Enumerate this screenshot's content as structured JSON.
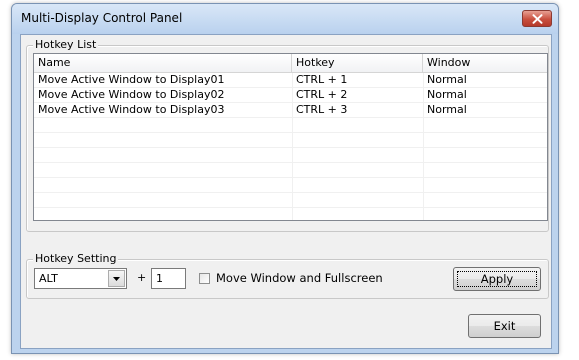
{
  "window": {
    "title": "Multi-Display Control Panel"
  },
  "hotkey_list": {
    "group_label": "Hotkey List",
    "columns": [
      "Name",
      "Hotkey",
      "Window"
    ],
    "rows": [
      {
        "name": "Move Active Window to Display01",
        "hotkey": "CTRL + 1",
        "window": "Normal"
      },
      {
        "name": "Move Active Window to Display02",
        "hotkey": "CTRL + 2",
        "window": "Normal"
      },
      {
        "name": "Move Active Window to Display03",
        "hotkey": "CTRL + 3",
        "window": "Normal"
      }
    ]
  },
  "hotkey_setting": {
    "group_label": "Hotkey Setting",
    "modifier_selected": "ALT",
    "plus": "+",
    "key_value": "1",
    "checkbox_label": "Move Window and Fullscreen",
    "checkbox_checked": false,
    "apply_label": "Apply"
  },
  "exit_label": "Exit",
  "icons": {
    "close": "close-icon",
    "dropdown": "chevron-down-icon"
  },
  "colors": {
    "title_bar": "#bcd3ee",
    "close_button": "#c9503f",
    "dialog_bg": "#f0f0f0"
  }
}
